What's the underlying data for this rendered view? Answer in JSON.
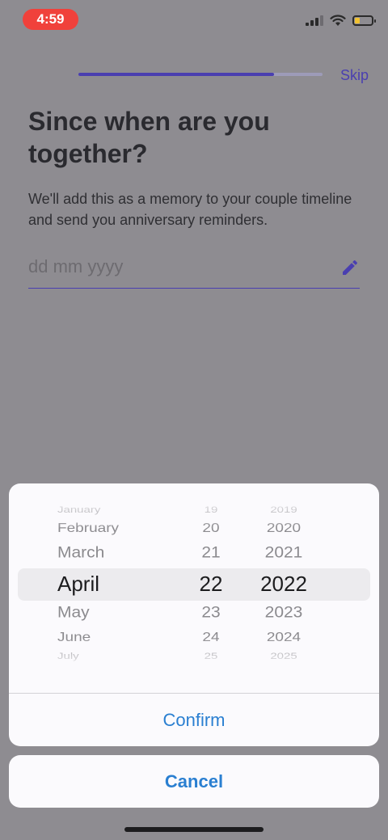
{
  "status_bar": {
    "time": "4:59",
    "battery_level": 0.3
  },
  "header": {
    "progress": 0.8,
    "skip_label": "Skip"
  },
  "main": {
    "title": "Since when are you together?",
    "subtitle": "We'll add this as a memory to your couple timeline and send you anniversary reminders.",
    "date_placeholder": "dd mm yyyy",
    "edit_icon": "pencil-icon"
  },
  "picker": {
    "months": [
      "January",
      "February",
      "March",
      "April",
      "May",
      "June",
      "July"
    ],
    "days": [
      "19",
      "20",
      "21",
      "22",
      "23",
      "24",
      "25"
    ],
    "years": [
      "2019",
      "2020",
      "2021",
      "2022",
      "2023",
      "2024",
      "2025"
    ],
    "selected": {
      "month": "April",
      "day": "22",
      "year": "2022"
    },
    "confirm_label": "Confirm"
  },
  "cancel_label": "Cancel",
  "colors": {
    "accent": "#4a3fb0",
    "action": "#2a7fd1",
    "time_pill": "#f0413b"
  }
}
